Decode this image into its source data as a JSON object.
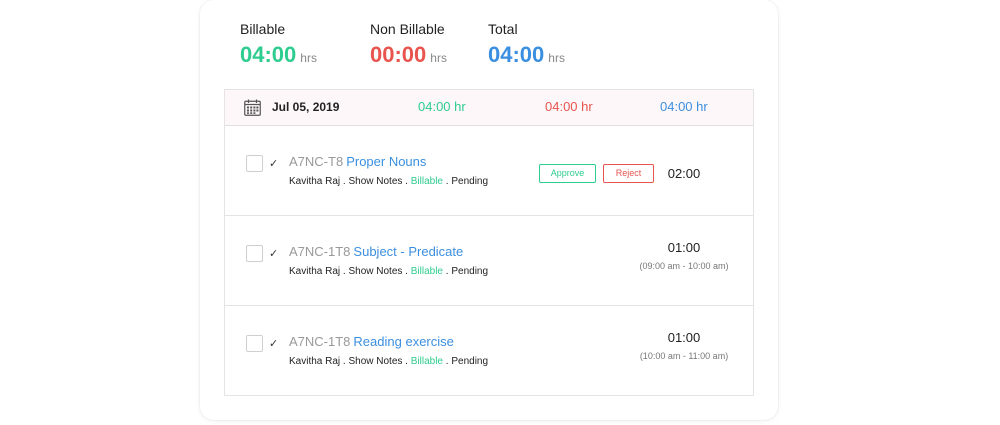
{
  "summary": {
    "billable": {
      "label": "Billable",
      "value": "04:00",
      "unit": "hrs"
    },
    "non_billable": {
      "label": "Non Billable",
      "value": "00:00",
      "unit": "hrs"
    },
    "total": {
      "label": "Total",
      "value": "04:00",
      "unit": "hrs"
    }
  },
  "colors": {
    "billable": "#2ecc8f",
    "non_billable": "#e8554e",
    "total": "#3b8fe0"
  },
  "date_row": {
    "date": "Jul 05, 2019",
    "billable_hr": "04:00 hr",
    "non_billable_hr": "04:00 hr",
    "total_hr": "04:00 hr",
    "icon": "calendar-icon"
  },
  "entries": [
    {
      "code": "A7NC-T8",
      "title": "Proper Nouns",
      "user": "Kavitha Raj",
      "category": "Show Notes",
      "billing": "Billable",
      "status": "Pending",
      "duration": "02:00",
      "approve_label": "Approve",
      "reject_label": "Reject"
    },
    {
      "code": "A7NC-1T8",
      "title": "Subject - Predicate",
      "user": "Kavitha Raj",
      "category": "Show Notes",
      "billing": "Billable",
      "status": "Pending",
      "duration": "01:00",
      "range": "(09:00 am - 10:00 am)"
    },
    {
      "code": "A7NC-1T8",
      "title": "Reading exercise",
      "user": "Kavitha Raj",
      "category": "Show Notes",
      "billing": "Billable",
      "status": "Pending",
      "duration": "01:00",
      "range": "(10:00 am - 11:00 am)"
    }
  ],
  "separator": " . ",
  "tick_glyph": "✓"
}
